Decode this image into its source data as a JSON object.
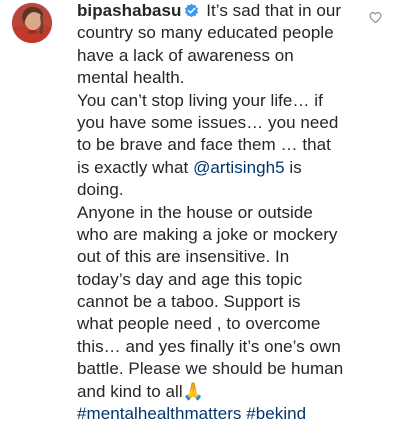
{
  "comment": {
    "username": "bipashabasu",
    "verified": true,
    "lines": {
      "l1": "It’s sad that in our",
      "l2": "country so many educated people",
      "l3": "have a lack of awareness on",
      "l4": "mental health.",
      "l5": "You can’t stop living your life… if",
      "l6": "you have some issues… you need",
      "l7": "to be brave and face them … that",
      "l8a": "is exactly what ",
      "l8b": "@artisingh5",
      "l8c": " is",
      "l9": "doing.",
      "l10": "Anyone in the house or outside",
      "l11": "who are making a joke or mockery",
      "l12": "out of this are insensitive. In",
      "l13": "today’s day and age this topic",
      "l14": "cannot be a taboo. Support is",
      "l15": "what people need , to overcome",
      "l16": "this… and yes finally it’s one’s own",
      "l17": "battle. Please we should be human",
      "l18": "and kind to all",
      "l18emoji": "🙏",
      "h1": "#mentalhealthmatters",
      "h2": "#bekind"
    }
  },
  "icons": {
    "verified": "verified-badge-icon",
    "like": "heart-outline-icon"
  },
  "colors": {
    "text": "#262626",
    "link": "#00376b",
    "verified": "#3897f0",
    "heart_stroke": "#8e8e8e"
  }
}
